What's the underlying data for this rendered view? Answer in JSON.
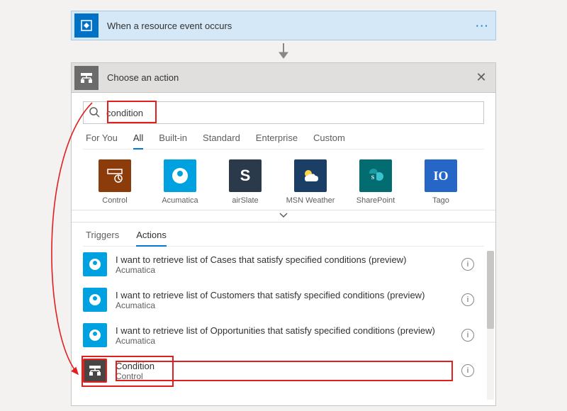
{
  "trigger": {
    "title": "When a resource event occurs"
  },
  "action_picker": {
    "title": "Choose an action",
    "search_value": "condition",
    "category_tabs": [
      "For You",
      "All",
      "Built-in",
      "Standard",
      "Enterprise",
      "Custom"
    ],
    "active_category": "All",
    "connectors": [
      {
        "name": "Control",
        "color": "#8c3b0a",
        "glyph": "control"
      },
      {
        "name": "Acumatica",
        "color": "#00a1e0",
        "glyph": "a"
      },
      {
        "name": "airSlate",
        "color": "#2b3a4a",
        "glyph": "S"
      },
      {
        "name": "MSN Weather",
        "color": "#1b3e66",
        "glyph": "weather"
      },
      {
        "name": "SharePoint",
        "color": "#036c70",
        "glyph": "sp"
      },
      {
        "name": "Tago",
        "color": "#2566c7",
        "glyph": "io"
      }
    ],
    "result_tabs": [
      "Triggers",
      "Actions"
    ],
    "active_result_tab": "Actions",
    "results": [
      {
        "title": "I want to retrieve list of Cases that satisfy specified conditions (preview)",
        "subtitle": "Acumatica",
        "icon": "acumatica"
      },
      {
        "title": "I want to retrieve list of Customers that satisfy specified conditions (preview)",
        "subtitle": "Acumatica",
        "icon": "acumatica"
      },
      {
        "title": "I want to retrieve list of Opportunities that satisfy specified conditions (preview)",
        "subtitle": "Acumatica",
        "icon": "acumatica"
      },
      {
        "title": "Condition",
        "subtitle": "Control",
        "icon": "control",
        "highlight": true
      }
    ]
  }
}
